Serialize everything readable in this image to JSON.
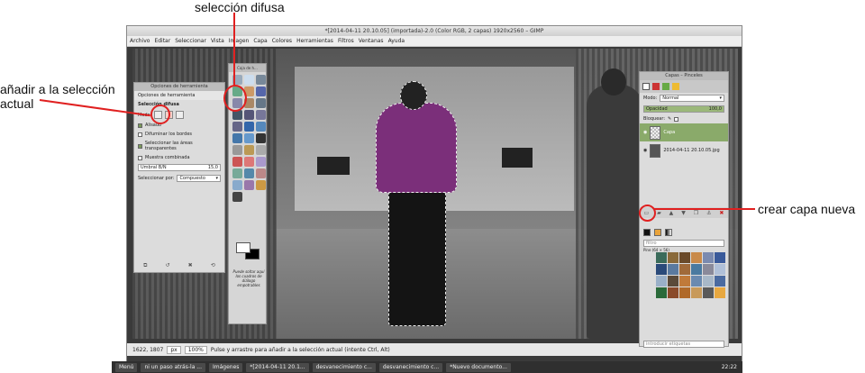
{
  "annotations": {
    "top": "selección difusa",
    "left": "añadir a la selección\nactual",
    "right": "crear capa nueva"
  },
  "window": {
    "title": "*[2014-04-11 20.10.05] (importada)-2.0 (Color RGB, 2 capas) 1920x2560 – GIMP",
    "menu": [
      "Archivo",
      "Editar",
      "Seleccionar",
      "Vista",
      "Imagen",
      "Capa",
      "Colores",
      "Herramientas",
      "Filtros",
      "Ventanas",
      "Ayuda"
    ]
  },
  "tool_options": {
    "header": "Opciones de herramienta",
    "tab": "Opciones de herramienta",
    "section": "Selección difusa",
    "mode_label": "Modo:",
    "antialias": "Alisado",
    "feather": "Difuminar los bordes",
    "select_transparent": "Seleccionar las áreas transparentes",
    "sample_merged": "Muestra combinada",
    "threshold_label": "Umbral B/N",
    "threshold_value": "15,0",
    "select_by_label": "Seleccionar por:",
    "select_by_value": "Compuesto"
  },
  "toolbox": {
    "header": "Caja de h...",
    "hint": "Puede soltar aquí los cuadros de diálogo empotrables"
  },
  "layers": {
    "header": "Capas – Pinceles",
    "mode_label": "Modo:",
    "mode_value": "Normal",
    "opacity_label": "Opacidad",
    "opacity_value": "100,0",
    "lock_label": "Bloquear:",
    "items": [
      "Capa",
      "2014-04-11 20.10.05.jpg"
    ],
    "pattern_filter": "filtro",
    "pattern_name": "Pine (64 × 56)",
    "tag_placeholder": "introducir etiquetas"
  },
  "status": {
    "coords": "1622, 1807",
    "unit": "px",
    "zoom": "100%",
    "message": "Pulse y arrastre para añadir a la selección actual (intente Ctrl, Alt)"
  },
  "taskbar": {
    "menu": "Menú",
    "tasks": [
      "ni un paso atrás-la ...",
      "Imágenes",
      "*[2014-04-11 20.1...",
      "desvanecimiento c...",
      "desvanecimiento c...",
      "*Nuevo documento..."
    ],
    "clock": "22:22"
  }
}
